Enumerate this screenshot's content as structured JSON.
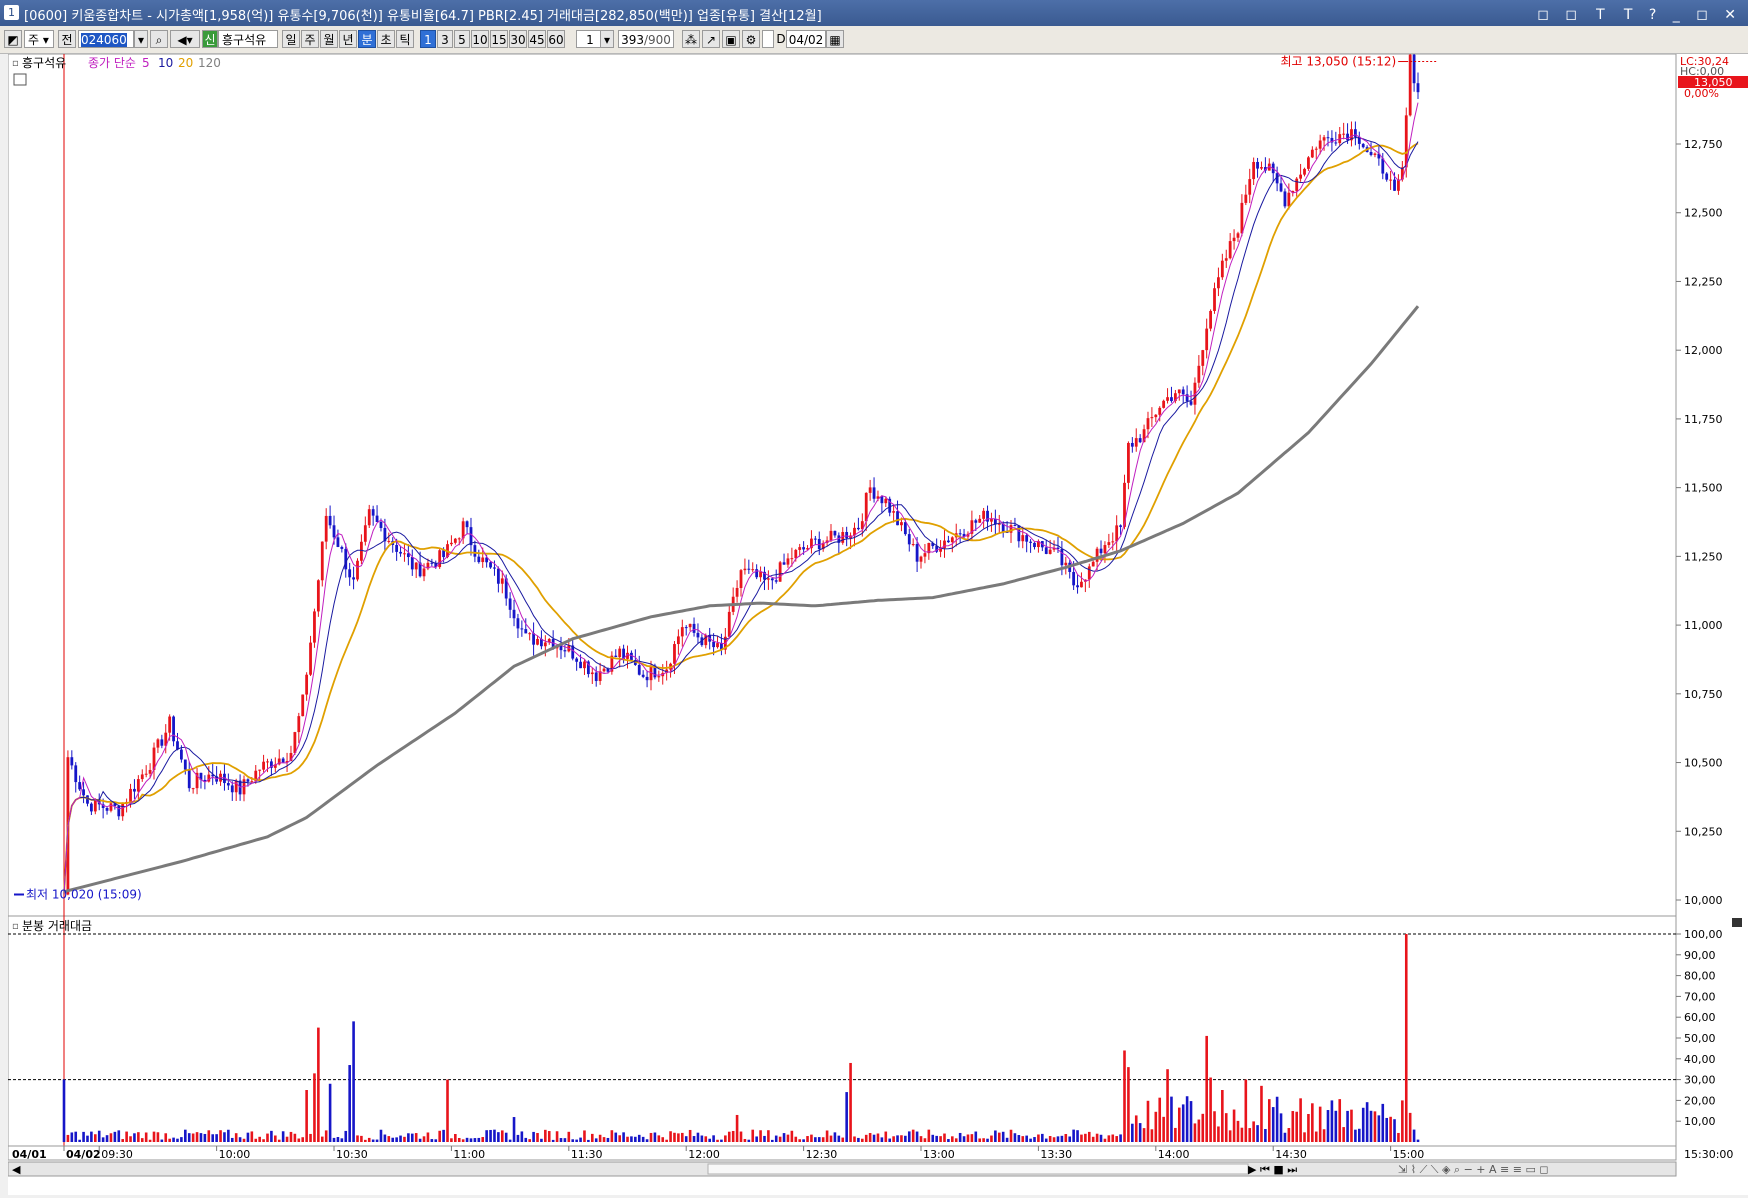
{
  "window": {
    "number": "1",
    "title": "[0600] 키움종합차트 - 시가총액[1,958(억)] 유통수[9,706(천)] 유통비율[64.7] PBR[2.45] 거래대금[282,850(백만)] 업종[유통] 결산[12월]",
    "buttons": "◻ ◻ Ｔ T ? _ ◻ ✕"
  },
  "toolbar": {
    "period_select": "주",
    "all_label": "전",
    "stock_code": "024060",
    "new_badge": "신",
    "stock_name": "흥구석유",
    "period_tabs": [
      "일",
      "주",
      "월",
      "년",
      "분",
      "초",
      "틱"
    ],
    "active_period": "분",
    "intervals": [
      "1",
      "3",
      "5",
      "10",
      "15",
      "30",
      "45",
      "60"
    ],
    "active_interval": "1",
    "multiplier": "1",
    "count_display": "393",
    "count_total": "/900",
    "date_label": "D",
    "date_value": "04/02"
  },
  "price_panel": {
    "stock_label": "흥구석유",
    "ma_label": "종가 단순",
    "ma_periods": [
      "5",
      "10",
      "20",
      "120"
    ],
    "ma_colors": [
      "#c020c0",
      "#1a1aa0",
      "#e0a000",
      "#808080"
    ],
    "high_annotation": "최고 13,050 (15:12)",
    "low_annotation": "최저 10,020 (15:09)",
    "right_lc": "LC:30,24",
    "right_hc": "HC:0,00",
    "current_price": "13,050",
    "current_change": "0,00%"
  },
  "volume_panel": {
    "label": "분봉 거래대금"
  },
  "colors": {
    "up": "#e8141b",
    "down": "#1616c8",
    "ma5": "#c020c0",
    "ma10": "#1a1aa0",
    "ma20": "#e0a000",
    "ma120": "#7a7a7a",
    "volume_max_bar": "#e8141b"
  },
  "chart_data": {
    "type": "candlestick",
    "y_axis": {
      "ticks": [
        "12,750",
        "12,500",
        "12,250",
        "12,000",
        "11,750",
        "11,500",
        "11,250",
        "11,000",
        "10,750",
        "10,500",
        "10,250",
        "10,000"
      ],
      "ylim": [
        10000,
        13200
      ]
    },
    "x_axis": {
      "left_date": "04/01",
      "tick_labels": [
        "04/02",
        "09:30",
        "10:00",
        "10:30",
        "11:00",
        "11:30",
        "12:00",
        "12:30",
        "13:00",
        "13:30",
        "14:00",
        "14:30",
        "15:00"
      ],
      "end_time": "15:30:00"
    },
    "volume_axis": {
      "ticks": [
        "100,00",
        "90,00",
        "80,00",
        "70,00",
        "60,00",
        "50,00",
        "40,00",
        "30,00",
        "20,00",
        "10,00"
      ],
      "ylim": [
        0,
        100
      ],
      "reference_lines": [
        100,
        30
      ]
    },
    "price_path": [
      {
        "t": 0,
        "p": 10020
      },
      {
        "t": 1,
        "p": 10520
      },
      {
        "t": 6,
        "p": 10350
      },
      {
        "t": 14,
        "p": 10330
      },
      {
        "t": 22,
        "p": 10500
      },
      {
        "t": 27,
        "p": 10640
      },
      {
        "t": 32,
        "p": 10420
      },
      {
        "t": 38,
        "p": 10460
      },
      {
        "t": 45,
        "p": 10400
      },
      {
        "t": 50,
        "p": 10480
      },
      {
        "t": 58,
        "p": 10540
      },
      {
        "t": 61,
        "p": 10720
      },
      {
        "t": 64,
        "p": 11050
      },
      {
        "t": 67,
        "p": 11400
      },
      {
        "t": 70,
        "p": 11300
      },
      {
        "t": 74,
        "p": 11150
      },
      {
        "t": 78,
        "p": 11400
      },
      {
        "t": 84,
        "p": 11300
      },
      {
        "t": 90,
        "p": 11200
      },
      {
        "t": 97,
        "p": 11250
      },
      {
        "t": 102,
        "p": 11360
      },
      {
        "t": 106,
        "p": 11250
      },
      {
        "t": 112,
        "p": 11150
      },
      {
        "t": 118,
        "p": 10950
      },
      {
        "t": 124,
        "p": 10950
      },
      {
        "t": 130,
        "p": 10900
      },
      {
        "t": 136,
        "p": 10820
      },
      {
        "t": 142,
        "p": 10900
      },
      {
        "t": 148,
        "p": 10820
      },
      {
        "t": 154,
        "p": 10850
      },
      {
        "t": 158,
        "p": 11000
      },
      {
        "t": 163,
        "p": 10950
      },
      {
        "t": 168,
        "p": 10900
      },
      {
        "t": 173,
        "p": 11200
      },
      {
        "t": 180,
        "p": 11150
      },
      {
        "t": 186,
        "p": 11250
      },
      {
        "t": 192,
        "p": 11300
      },
      {
        "t": 198,
        "p": 11320
      },
      {
        "t": 203,
        "p": 11360
      },
      {
        "t": 206,
        "p": 11500
      },
      {
        "t": 210,
        "p": 11450
      },
      {
        "t": 214,
        "p": 11350
      },
      {
        "t": 218,
        "p": 11250
      },
      {
        "t": 224,
        "p": 11300
      },
      {
        "t": 230,
        "p": 11350
      },
      {
        "t": 236,
        "p": 11400
      },
      {
        "t": 242,
        "p": 11350
      },
      {
        "t": 248,
        "p": 11300
      },
      {
        "t": 254,
        "p": 11250
      },
      {
        "t": 258,
        "p": 11150
      },
      {
        "t": 262,
        "p": 11200
      },
      {
        "t": 266,
        "p": 11300
      },
      {
        "t": 270,
        "p": 11350
      },
      {
        "t": 272,
        "p": 11650
      },
      {
        "t": 276,
        "p": 11700
      },
      {
        "t": 280,
        "p": 11800
      },
      {
        "t": 284,
        "p": 11850
      },
      {
        "t": 288,
        "p": 11800
      },
      {
        "t": 292,
        "p": 12100
      },
      {
        "t": 296,
        "p": 12300
      },
      {
        "t": 300,
        "p": 12450
      },
      {
        "t": 304,
        "p": 12700
      },
      {
        "t": 308,
        "p": 12650
      },
      {
        "t": 312,
        "p": 12550
      },
      {
        "t": 316,
        "p": 12650
      },
      {
        "t": 320,
        "p": 12750
      },
      {
        "t": 324,
        "p": 12780
      },
      {
        "t": 330,
        "p": 12800
      },
      {
        "t": 334,
        "p": 12700
      },
      {
        "t": 338,
        "p": 12650
      },
      {
        "t": 340,
        "p": 12550
      },
      {
        "t": 342,
        "p": 12650
      },
      {
        "t": 344,
        "p": 13050
      },
      {
        "t": 346,
        "p": 12950
      }
    ],
    "ma120_path": [
      {
        "t": 0,
        "p": 10030
      },
      {
        "t": 30,
        "p": 10140
      },
      {
        "t": 52,
        "p": 10230
      },
      {
        "t": 62,
        "p": 10300
      },
      {
        "t": 80,
        "p": 10490
      },
      {
        "t": 100,
        "p": 10680
      },
      {
        "t": 115,
        "p": 10850
      },
      {
        "t": 130,
        "p": 10950
      },
      {
        "t": 150,
        "p": 11030
      },
      {
        "t": 165,
        "p": 11070
      },
      {
        "t": 178,
        "p": 11080
      },
      {
        "t": 192,
        "p": 11070
      },
      {
        "t": 208,
        "p": 11090
      },
      {
        "t": 222,
        "p": 11100
      },
      {
        "t": 240,
        "p": 11150
      },
      {
        "t": 256,
        "p": 11210
      },
      {
        "t": 270,
        "p": 11270
      },
      {
        "t": 286,
        "p": 11370
      },
      {
        "t": 300,
        "p": 11480
      },
      {
        "t": 318,
        "p": 11700
      },
      {
        "t": 334,
        "p": 11950
      },
      {
        "t": 346,
        "p": 12160
      }
    ],
    "volume_spikes": [
      {
        "t": 0,
        "v": 30
      },
      {
        "t": 62,
        "v": 25
      },
      {
        "t": 64,
        "v": 33
      },
      {
        "t": 65,
        "v": 55
      },
      {
        "t": 68,
        "v": 28
      },
      {
        "t": 74,
        "v": 58
      },
      {
        "t": 73,
        "v": 37
      },
      {
        "t": 98,
        "v": 30
      },
      {
        "t": 115,
        "v": 12
      },
      {
        "t": 172,
        "v": 13
      },
      {
        "t": 200,
        "v": 24
      },
      {
        "t": 201,
        "v": 38
      },
      {
        "t": 271,
        "v": 44
      },
      {
        "t": 272,
        "v": 36
      },
      {
        "t": 282,
        "v": 35
      },
      {
        "t": 287,
        "v": 22
      },
      {
        "t": 292,
        "v": 51
      },
      {
        "t": 293,
        "v": 31
      },
      {
        "t": 296,
        "v": 25
      },
      {
        "t": 302,
        "v": 30
      },
      {
        "t": 306,
        "v": 27
      },
      {
        "t": 316,
        "v": 21
      },
      {
        "t": 324,
        "v": 20
      },
      {
        "t": 334,
        "v": 15
      },
      {
        "t": 342,
        "v": 20
      },
      {
        "t": 343,
        "v": 100
      },
      {
        "t": 344,
        "v": 14
      }
    ]
  }
}
